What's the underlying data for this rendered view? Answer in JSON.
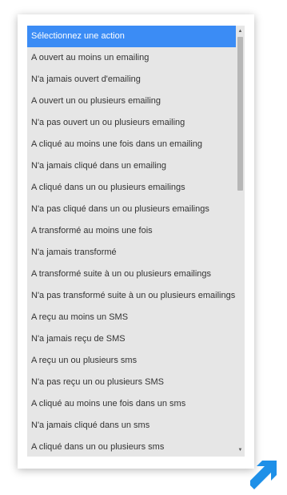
{
  "listbox": {
    "options": [
      "Sélectionnez une action",
      "A ouvert au moins un emailing",
      "N'a jamais ouvert d'emailing",
      "A ouvert un ou plusieurs emailing",
      "N'a pas ouvert un ou plusieurs emailing",
      "A cliqué au moins une fois dans un emailing",
      "N'a jamais cliqué dans un emailing",
      "A cliqué dans un ou plusieurs emailings",
      "N'a pas cliqué dans un ou plusieurs emailings",
      "A transformé au moins une fois",
      "N'a jamais transformé",
      "A transformé suite à un ou plusieurs emailings",
      "N'a pas transformé suite à un ou plusieurs emailings",
      "A reçu au moins un SMS",
      "N'a jamais reçu de SMS",
      "A reçu un ou plusieurs sms",
      "N'a pas reçu un ou plusieurs SMS",
      "A cliqué au moins une fois dans un sms",
      "N'a jamais cliqué dans un sms",
      "A cliqué dans un ou plusieurs sms"
    ],
    "selected_index": 0
  },
  "scrollbar": {
    "up_icon": "triangle-up-icon",
    "down_icon": "triangle-down-icon"
  },
  "colors": {
    "selected_background": "#3b8cf5",
    "list_background": "#e6e6e6",
    "corner_arrow": "#1e90e8"
  },
  "corner_icon": "diagonal-arrow-icon"
}
